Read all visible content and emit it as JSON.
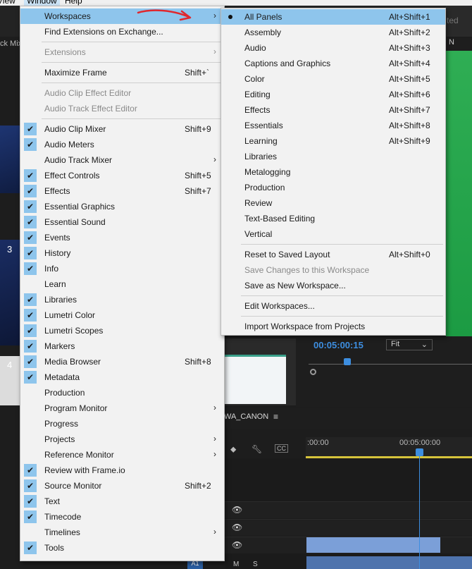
{
  "app": {
    "menubar": {
      "view": "View",
      "window": "Window",
      "help": "Help"
    },
    "background": {
      "mixer_tab": "ck Mixe",
      "clip_numbers": [
        "3",
        "4"
      ],
      "program_timecode": "00:05:00:15",
      "fit_select": "Fit",
      "sequence_name": "WA_CANON",
      "timeline_ticks": [
        ":00:00",
        "00:05:00:00"
      ],
      "a1_label": "A1",
      "m_label": "M",
      "s_label": "S",
      "right_tab_fragment": "N",
      "top_right_text": "ted"
    }
  },
  "window_menu": {
    "items": [
      {
        "label": "Workspaces",
        "submenu": true,
        "selected": true
      },
      {
        "label": "Find Extensions on Exchange..."
      },
      {
        "separator": true
      },
      {
        "label": "Extensions",
        "submenu": true,
        "disabled": true
      },
      {
        "separator": true
      },
      {
        "label": "Maximize Frame",
        "shortcut": "Shift+`"
      },
      {
        "separator": true
      },
      {
        "label": "Audio Clip Effect Editor",
        "disabled": true
      },
      {
        "label": "Audio Track Effect Editor",
        "disabled": true
      },
      {
        "separator": true
      },
      {
        "label": "Audio Clip Mixer",
        "checked": true,
        "shortcut": "Shift+9"
      },
      {
        "label": "Audio Meters",
        "checked": true
      },
      {
        "label": "Audio Track Mixer",
        "submenu": true
      },
      {
        "label": "Effect Controls",
        "checked": true,
        "shortcut": "Shift+5"
      },
      {
        "label": "Effects",
        "checked": true,
        "shortcut": "Shift+7"
      },
      {
        "label": "Essential Graphics",
        "checked": true
      },
      {
        "label": "Essential Sound",
        "checked": true
      },
      {
        "label": "Events",
        "checked": true
      },
      {
        "label": "History",
        "checked": true
      },
      {
        "label": "Info",
        "checked": true
      },
      {
        "label": "Learn"
      },
      {
        "label": "Libraries",
        "checked": true
      },
      {
        "label": "Lumetri Color",
        "checked": true
      },
      {
        "label": "Lumetri Scopes",
        "checked": true
      },
      {
        "label": "Markers",
        "checked": true
      },
      {
        "label": "Media Browser",
        "checked": true,
        "shortcut": "Shift+8"
      },
      {
        "label": "Metadata",
        "checked": true
      },
      {
        "label": "Production"
      },
      {
        "label": "Program Monitor",
        "submenu": true
      },
      {
        "label": "Progress"
      },
      {
        "label": "Projects",
        "submenu": true
      },
      {
        "label": "Reference Monitor",
        "submenu": true
      },
      {
        "label": "Review with Frame.io",
        "checked": true
      },
      {
        "label": "Source Monitor",
        "checked": true,
        "shortcut": "Shift+2"
      },
      {
        "label": "Text",
        "checked": true
      },
      {
        "label": "Timecode",
        "checked": true
      },
      {
        "label": "Timelines",
        "submenu": true
      },
      {
        "label": "Tools",
        "checked": true
      }
    ],
    "check_glyph": "✔",
    "submenu_glyph": "›"
  },
  "workspaces_submenu": {
    "items": [
      {
        "label": "All Panels",
        "shortcut": "Alt+Shift+1",
        "active": true,
        "selected": true
      },
      {
        "label": "Assembly",
        "shortcut": "Alt+Shift+2"
      },
      {
        "label": "Audio",
        "shortcut": "Alt+Shift+3"
      },
      {
        "label": "Captions and Graphics",
        "shortcut": "Alt+Shift+4"
      },
      {
        "label": "Color",
        "shortcut": "Alt+Shift+5"
      },
      {
        "label": "Editing",
        "shortcut": "Alt+Shift+6"
      },
      {
        "label": "Effects",
        "shortcut": "Alt+Shift+7"
      },
      {
        "label": "Essentials",
        "shortcut": "Alt+Shift+8"
      },
      {
        "label": "Learning",
        "shortcut": "Alt+Shift+9"
      },
      {
        "label": "Libraries"
      },
      {
        "label": "Metalogging"
      },
      {
        "label": "Production"
      },
      {
        "label": "Review"
      },
      {
        "label": "Text-Based Editing"
      },
      {
        "label": "Vertical"
      },
      {
        "separator": true
      },
      {
        "label": "Reset to Saved Layout",
        "shortcut": "Alt+Shift+0"
      },
      {
        "label": "Save Changes to this Workspace",
        "disabled": true
      },
      {
        "label": "Save as New Workspace..."
      },
      {
        "separator": true
      },
      {
        "label": "Edit Workspaces..."
      },
      {
        "separator": true
      },
      {
        "label": "Import Workspace from Projects"
      }
    ]
  },
  "colors": {
    "highlight": "#8ec5ec",
    "menu_bg": "#f2f2f2",
    "disabled_text": "#8a8a8a",
    "annotation_arrow": "#e0282e",
    "timecode_blue": "#3d8ee0"
  }
}
